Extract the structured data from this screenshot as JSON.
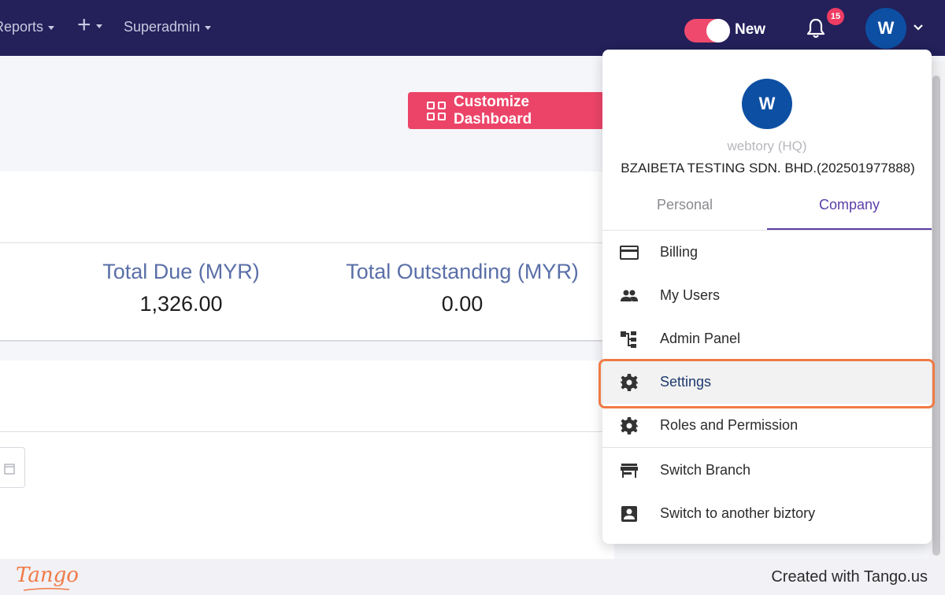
{
  "navbar": {
    "reports_label": "Reports",
    "superadmin_label": "Superadmin",
    "toggle_label": "New",
    "notification_count": "15",
    "avatar_initial": "W"
  },
  "dashboard": {
    "customize_label": "Customize Dashboard",
    "stats": [
      {
        "label": "Total Due (MYR)",
        "value": "1,326.00"
      },
      {
        "label": "Total Outstanding (MYR)",
        "value": "0.00"
      }
    ]
  },
  "dropdown": {
    "avatar_initial": "W",
    "user_name": "webtory (HQ)",
    "company_name": "BZAIBETA TESTING SDN. BHD.(202501977888)",
    "tabs": [
      {
        "label": "Personal",
        "active": false
      },
      {
        "label": "Company",
        "active": true
      }
    ],
    "menu": [
      {
        "label": "Billing",
        "icon": "credit-card-icon"
      },
      {
        "label": "My Users",
        "icon": "users-icon"
      },
      {
        "label": "Admin Panel",
        "icon": "hierarchy-icon"
      },
      {
        "label": "Settings",
        "icon": "gear-icon",
        "highlighted": true
      },
      {
        "label": "Roles and Permission",
        "icon": "gear-icon"
      },
      {
        "label": "Switch Branch",
        "icon": "store-icon"
      },
      {
        "label": "Switch to another biztory",
        "icon": "account-box-icon"
      }
    ]
  },
  "footer": {
    "logo_text": "Tango",
    "credit_text": "Created with Tango.us"
  },
  "colors": {
    "navbar": "#23205a",
    "accent_pink": "#ec4468",
    "avatar_blue": "#0d4fa3",
    "tab_active": "#5b3ea8",
    "highlight_orange": "#f07a45"
  }
}
